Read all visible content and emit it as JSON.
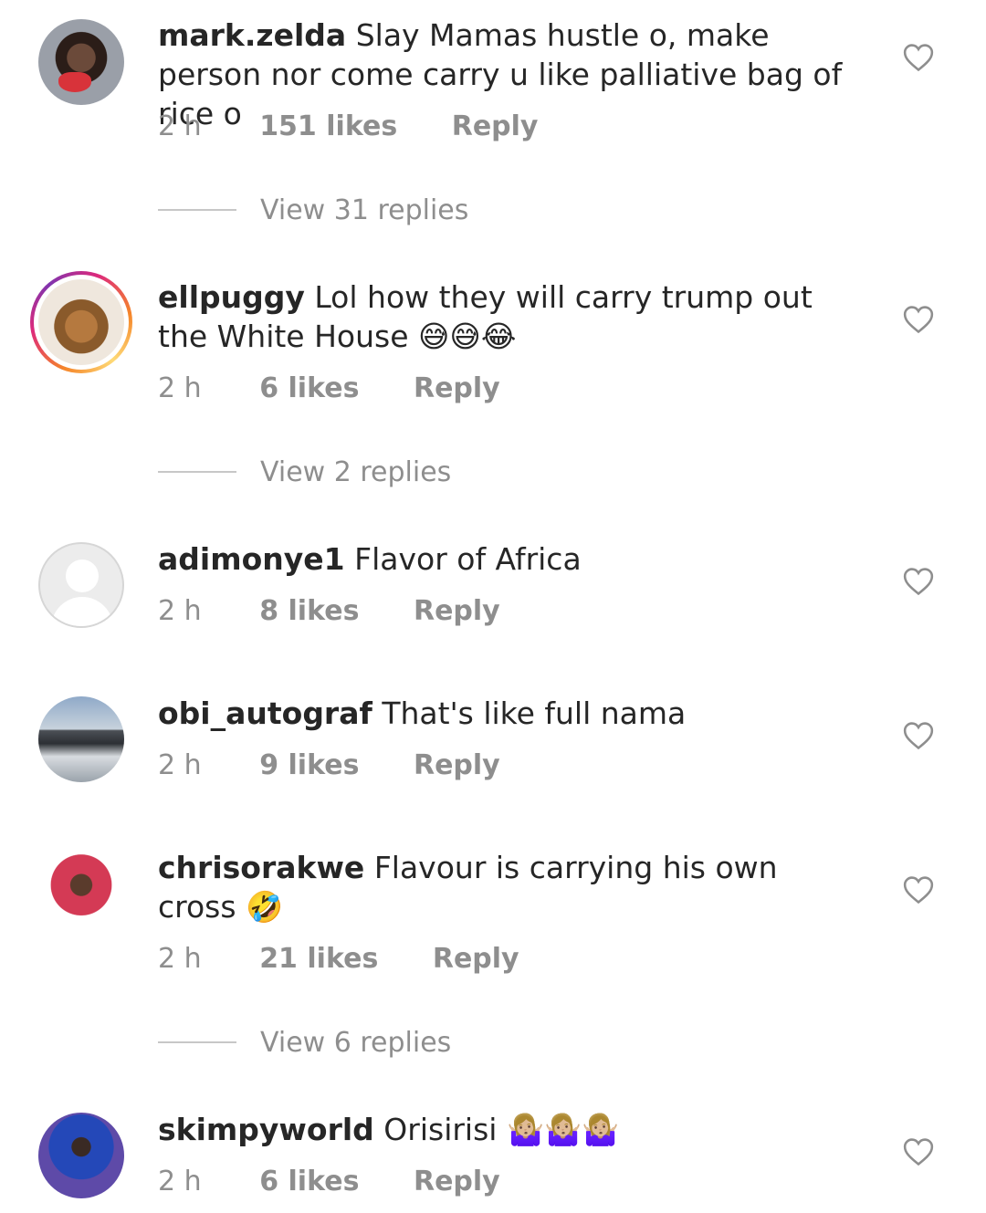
{
  "comments": [
    {
      "username": "mark.zelda",
      "text": "Slay Mamas hustle o, make person nor come carry u like palliative bag of rice o",
      "emoji": "",
      "time": "2 h",
      "likes": "151 likes",
      "reply": "Reply",
      "view_replies": "View 31 replies"
    },
    {
      "username": "ellpuggy",
      "text": "Lol how they will carry trump out the White House",
      "emoji": "😅😅😂",
      "time": "2 h",
      "likes": "6 likes",
      "reply": "Reply",
      "view_replies": "View 2 replies"
    },
    {
      "username": "adimonye1",
      "text": "Flavor of Africa",
      "emoji": "",
      "time": "2 h",
      "likes": "8 likes",
      "reply": "Reply"
    },
    {
      "username": "obi_autograf",
      "text": "That's like full nama",
      "emoji": "",
      "time": "2 h",
      "likes": "9 likes",
      "reply": "Reply"
    },
    {
      "username": "chrisorakwe",
      "text": "Flavour is carrying his own cross",
      "emoji": "🤣",
      "time": "2 h",
      "likes": "21 likes",
      "reply": "Reply",
      "view_replies": "View 6 replies"
    },
    {
      "username": "skimpyworld",
      "text": "Orisirisi",
      "emoji": "🤷🏼‍♀️🤷🏼‍♀️🤷🏼‍♀️",
      "time": "2 h",
      "likes": "6 likes",
      "reply": "Reply"
    }
  ],
  "icons": {
    "like": "heart-outline-icon",
    "avatar_placeholder": "default-user-icon"
  },
  "colors": {
    "text": "#262626",
    "muted": "#8e8e8e",
    "divider": "#c7c7c7"
  }
}
